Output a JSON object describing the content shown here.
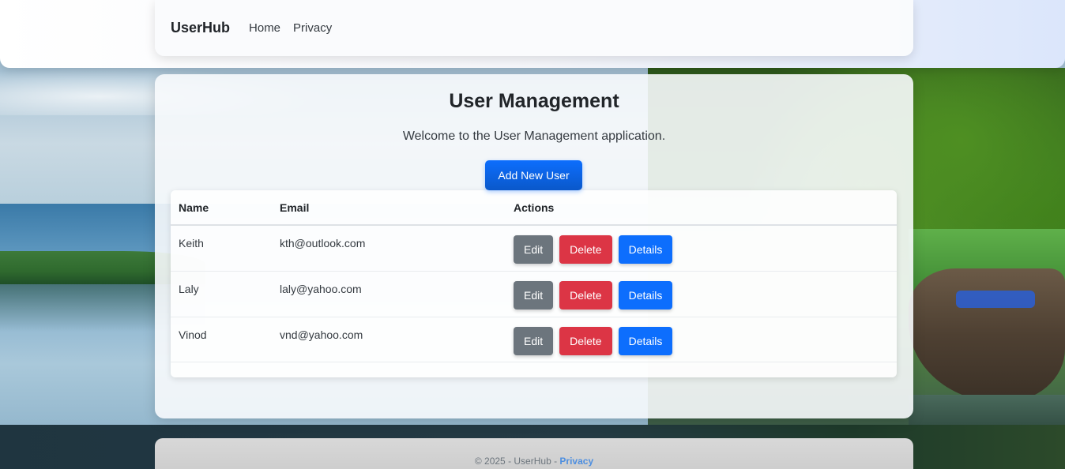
{
  "navbar": {
    "brand": "UserHub",
    "links": [
      "Home",
      "Privacy"
    ]
  },
  "main": {
    "title": "User Management",
    "welcome": "Welcome to the User Management application.",
    "add_button": "Add New User",
    "table": {
      "headers": [
        "Name",
        "Email",
        "Actions"
      ],
      "rows": [
        {
          "name": "Keith",
          "email": "kth@outlook.com"
        },
        {
          "name": "Laly",
          "email": "laly@yahoo.com"
        },
        {
          "name": "Vinod",
          "email": "vnd@yahoo.com"
        }
      ],
      "actions": {
        "edit": "Edit",
        "delete": "Delete",
        "details": "Details"
      }
    }
  },
  "footer": {
    "text": "© 2025 - UserHub - ",
    "link": "Privacy"
  },
  "colors": {
    "primary": "#0d6efd",
    "secondary": "#6c757d",
    "danger": "#dc3545"
  }
}
